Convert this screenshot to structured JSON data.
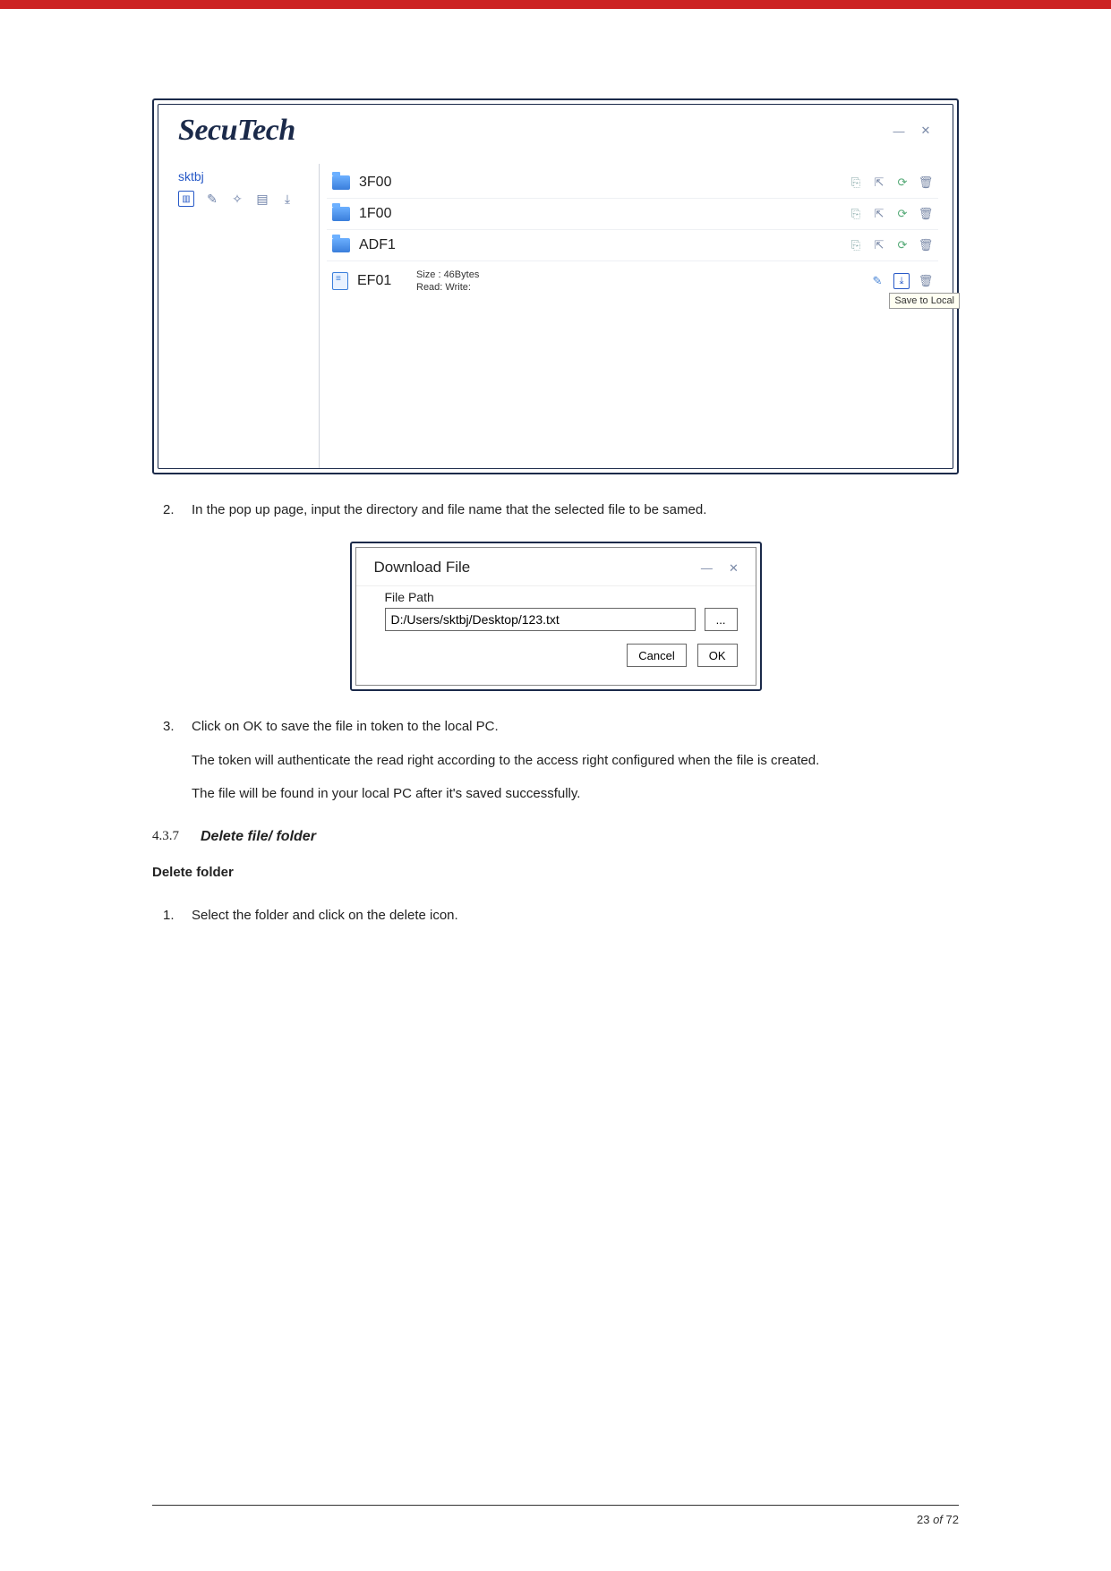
{
  "app": {
    "brand": "SecuTech",
    "window_controls": {
      "minimize": "—",
      "close": "✕"
    },
    "sidebar": {
      "label": "sktbj"
    },
    "rows": [
      {
        "name": "3F00"
      },
      {
        "name": "1F00"
      },
      {
        "name": "ADF1"
      },
      {
        "name": "EF01",
        "meta_size": "Size : 46Bytes",
        "meta_perm": "Read:  Write:"
      }
    ],
    "tooltip": "Save to Local"
  },
  "steps": [
    {
      "num": "2.",
      "text": "In the pop up page, input the directory and file name that the selected file to be samed."
    },
    {
      "num": "3.",
      "text": "Click on OK to save the file in token to the local PC.",
      "sub1": "The token will authenticate the read right according to the access right configured when the file is created.",
      "sub2": "The file will be found in your local PC after it's saved successfully."
    }
  ],
  "dialog": {
    "title": "Download File",
    "win": {
      "minimize": "—",
      "close": "✕"
    },
    "field_label": "File Path",
    "path_value": "D:/Users/sktbj/Desktop/123.txt",
    "browse_label": "...",
    "cancel_label": "Cancel",
    "ok_label": "OK"
  },
  "section": {
    "number": "4.3.7",
    "title": "Delete file/ folder",
    "subhead": "Delete folder",
    "steps": [
      {
        "num": "1.",
        "text": "Select the folder and click on the delete icon."
      }
    ]
  },
  "footer": {
    "page": "23 ",
    "of": "of ",
    "total": "72"
  }
}
